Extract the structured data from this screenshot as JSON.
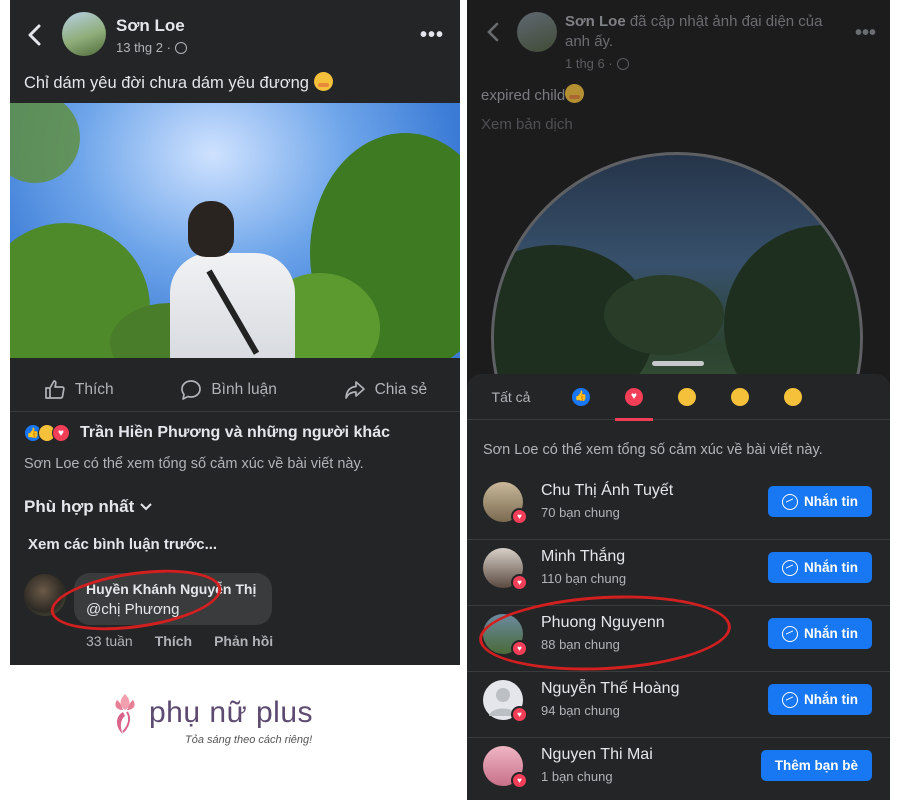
{
  "left_post": {
    "author": "Sơn Loe",
    "date": "13 thg 2 ·",
    "caption": "Chỉ dám yêu đời chưa dám yêu đương",
    "actions": {
      "like": "Thích",
      "comment": "Bình luận",
      "share": "Chia sẻ"
    },
    "reactions_text": "Trần Hiền Phương và những người khác",
    "private_note": "Sơn Loe có thể xem tổng số cảm xúc về bài viết này.",
    "sort_label": "Phù hợp nhất",
    "previous_comments": "Xem các bình luận trước...",
    "comment": {
      "author": "Huyền Khánh Nguyễn Thị",
      "text": "@chị Phương",
      "time": "33 tuần",
      "like": "Thích",
      "reply": "Phản hồi"
    }
  },
  "logo": {
    "brand": "phụ nữ plus",
    "tagline": "Tỏa sáng theo cách riêng!"
  },
  "right_post": {
    "author": "Sơn Loe",
    "headline_rest": " đã cập nhật ảnh đại diện của anh ấy.",
    "date": "1 thg 6 ·",
    "caption": "expired child",
    "translate": "Xem bản dịch"
  },
  "reaction_sheet": {
    "tab_all": "Tất cả",
    "tabs": [
      "like-icon",
      "love-icon",
      "haha-icon",
      "care-icon",
      "wow-icon"
    ],
    "note": "Sơn Loe có thể xem tổng số cảm xúc về bài viết này.",
    "people": [
      {
        "name": "Chu Thị Ánh Tuyết",
        "mutual": "70 bạn chung",
        "button": "Nhắn tin"
      },
      {
        "name": "Minh Thắng",
        "mutual": "110 bạn chung",
        "button": "Nhắn tin"
      },
      {
        "name": "Phuong Nguyenn",
        "mutual": "88 bạn chung",
        "button": "Nhắn tin"
      },
      {
        "name": "Nguyễn Thế Hoàng",
        "mutual": "94 bạn chung",
        "button": "Nhắn tin"
      },
      {
        "name": "Nguyen Thi Mai",
        "mutual": "1 bạn chung",
        "button": "Thêm bạn bè"
      }
    ]
  },
  "colors": {
    "facebook_blue": "#1877f2",
    "love_red": "#f33e58",
    "annotation_red": "#d21f1f",
    "dark_surface": "#242526"
  }
}
